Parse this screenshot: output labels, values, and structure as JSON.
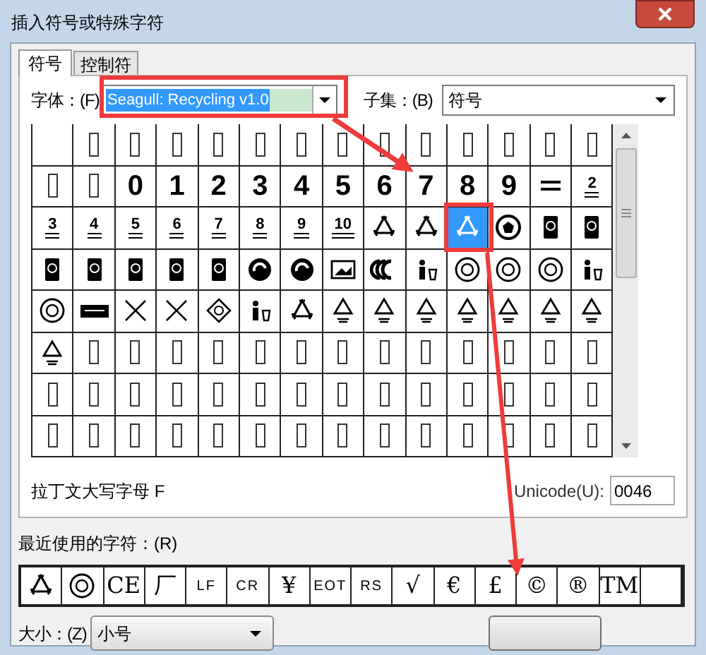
{
  "window": {
    "title": "插入符号或特殊字符"
  },
  "tabs": [
    {
      "label": "符号",
      "selected": true
    },
    {
      "label": "控制符",
      "selected": false
    }
  ],
  "font": {
    "label": "字体：",
    "mnemonic": "(F)",
    "value": "Seagull: Recycling v1.0",
    "highlighted": true
  },
  "subset": {
    "label": "子集：",
    "mnemonic": "(B)",
    "value": "符号"
  },
  "grid": {
    "rows": [
      {
        "cells": [
          {
            "kind": "empty",
            "selected": false
          },
          {
            "kind": "missing",
            "selected": false
          },
          {
            "kind": "missing",
            "selected": false
          },
          {
            "kind": "missing",
            "selected": false
          },
          {
            "kind": "missing",
            "selected": false
          },
          {
            "kind": "missing",
            "selected": false
          },
          {
            "kind": "missing",
            "selected": false
          },
          {
            "kind": "missing",
            "selected": false
          },
          {
            "kind": "missing",
            "selected": false
          },
          {
            "kind": "missing",
            "selected": false
          },
          {
            "kind": "missing",
            "selected": false
          },
          {
            "kind": "missing",
            "selected": false
          },
          {
            "kind": "missing",
            "selected": false
          },
          {
            "kind": "missing",
            "selected": false
          }
        ]
      },
      {
        "cells": [
          {
            "kind": "missing",
            "selected": false
          },
          {
            "kind": "missing",
            "selected": false
          },
          {
            "kind": "digit",
            "text": "0",
            "selected": false
          },
          {
            "kind": "digit",
            "text": "1",
            "selected": false
          },
          {
            "kind": "digit",
            "text": "2",
            "selected": false
          },
          {
            "kind": "digit",
            "text": "3",
            "selected": false
          },
          {
            "kind": "digit",
            "text": "4",
            "selected": false
          },
          {
            "kind": "digit",
            "text": "5",
            "selected": false
          },
          {
            "kind": "digit",
            "text": "6",
            "selected": false
          },
          {
            "kind": "digit",
            "text": "7",
            "selected": false
          },
          {
            "kind": "digit",
            "text": "8",
            "selected": false
          },
          {
            "kind": "digit",
            "text": "9",
            "selected": false
          },
          {
            "kind": "bars",
            "selected": false
          },
          {
            "kind": "numbered",
            "text": "2",
            "selected": false
          }
        ]
      },
      {
        "cells": [
          {
            "kind": "numbered",
            "text": "3",
            "selected": false
          },
          {
            "kind": "numbered",
            "text": "4",
            "selected": false
          },
          {
            "kind": "numbered",
            "text": "5",
            "selected": false
          },
          {
            "kind": "numbered",
            "text": "6",
            "selected": false
          },
          {
            "kind": "numbered",
            "text": "7",
            "selected": false
          },
          {
            "kind": "numbered",
            "text": "8",
            "selected": false
          },
          {
            "kind": "numbered",
            "text": "9",
            "selected": false
          },
          {
            "kind": "numbered",
            "text": "10",
            "selected": false
          },
          {
            "kind": "recycle",
            "selected": false
          },
          {
            "kind": "recycle",
            "selected": false
          },
          {
            "kind": "recycle",
            "selected": true
          },
          {
            "kind": "disc",
            "selected": false
          },
          {
            "kind": "tag",
            "selected": false
          },
          {
            "kind": "tag",
            "selected": false
          }
        ]
      },
      {
        "cells": [
          {
            "kind": "tag",
            "selected": false
          },
          {
            "kind": "tag",
            "selected": false
          },
          {
            "kind": "tag",
            "selected": false
          },
          {
            "kind": "tag",
            "selected": false
          },
          {
            "kind": "tag",
            "selected": false
          },
          {
            "kind": "swirl",
            "selected": false
          },
          {
            "kind": "swirl",
            "selected": false
          },
          {
            "kind": "photo",
            "selected": false
          },
          {
            "kind": "arcs",
            "selected": false
          },
          {
            "kind": "figure",
            "selected": false
          },
          {
            "kind": "seal",
            "selected": false
          },
          {
            "kind": "seal",
            "selected": false
          },
          {
            "kind": "seal",
            "selected": false
          },
          {
            "kind": "figure",
            "selected": false
          }
        ]
      },
      {
        "cells": [
          {
            "kind": "seal",
            "selected": false
          },
          {
            "kind": "banner",
            "selected": false
          },
          {
            "kind": "cross",
            "selected": false
          },
          {
            "kind": "cross",
            "selected": false
          },
          {
            "kind": "diamond",
            "selected": false
          },
          {
            "kind": "figure",
            "selected": false
          },
          {
            "kind": "recycle",
            "selected": false
          },
          {
            "kind": "code",
            "selected": false
          },
          {
            "kind": "code",
            "selected": false
          },
          {
            "kind": "code",
            "selected": false
          },
          {
            "kind": "code",
            "selected": false
          },
          {
            "kind": "code",
            "selected": false
          },
          {
            "kind": "code",
            "selected": false
          },
          {
            "kind": "code",
            "selected": false
          }
        ]
      },
      {
        "cells": [
          {
            "kind": "code",
            "selected": false
          },
          {
            "kind": "missing",
            "selected": false
          },
          {
            "kind": "missing",
            "selected": false
          },
          {
            "kind": "missing",
            "selected": false
          },
          {
            "kind": "missing",
            "selected": false
          },
          {
            "kind": "missing",
            "selected": false
          },
          {
            "kind": "missing",
            "selected": false
          },
          {
            "kind": "missing",
            "selected": false
          },
          {
            "kind": "missing",
            "selected": false
          },
          {
            "kind": "missing",
            "selected": false
          },
          {
            "kind": "missing",
            "selected": false
          },
          {
            "kind": "missing",
            "selected": false
          },
          {
            "kind": "missing",
            "selected": false
          },
          {
            "kind": "missing",
            "selected": false
          }
        ]
      },
      {
        "cells": [
          {
            "kind": "missing",
            "selected": false
          },
          {
            "kind": "missing",
            "selected": false
          },
          {
            "kind": "missing",
            "selected": false
          },
          {
            "kind": "missing",
            "selected": false
          },
          {
            "kind": "missing",
            "selected": false
          },
          {
            "kind": "missing",
            "selected": false
          },
          {
            "kind": "missing",
            "selected": false
          },
          {
            "kind": "missing",
            "selected": false
          },
          {
            "kind": "missing",
            "selected": false
          },
          {
            "kind": "missing",
            "selected": false
          },
          {
            "kind": "missing",
            "selected": false
          },
          {
            "kind": "missing",
            "selected": false
          },
          {
            "kind": "missing",
            "selected": false
          },
          {
            "kind": "missing",
            "selected": false
          }
        ]
      },
      {
        "cells": [
          {
            "kind": "missing",
            "selected": false
          },
          {
            "kind": "missing",
            "selected": false
          },
          {
            "kind": "missing",
            "selected": false
          },
          {
            "kind": "missing",
            "selected": false
          },
          {
            "kind": "missing",
            "selected": false
          },
          {
            "kind": "missing",
            "selected": false
          },
          {
            "kind": "missing",
            "selected": false
          },
          {
            "kind": "missing",
            "selected": false
          },
          {
            "kind": "missing",
            "selected": false
          },
          {
            "kind": "missing",
            "selected": false
          },
          {
            "kind": "missing",
            "selected": false
          },
          {
            "kind": "missing",
            "selected": false
          },
          {
            "kind": "missing",
            "selected": false
          },
          {
            "kind": "missing",
            "selected": false
          }
        ]
      }
    ]
  },
  "character_name": "拉丁文大写字母 F",
  "unicode": {
    "label": "Unicode",
    "mnemonic": "(U):",
    "value": "0046"
  },
  "recent": {
    "label": "最近使用的字符：",
    "mnemonic": "(R)",
    "items": [
      {
        "kind": "recycle"
      },
      {
        "kind": "seal"
      },
      {
        "kind": "text",
        "text": "CE"
      },
      {
        "kind": "text",
        "text": "厂"
      },
      {
        "kind": "code",
        "text": "LF"
      },
      {
        "kind": "code",
        "text": "CR"
      },
      {
        "kind": "text",
        "text": "¥"
      },
      {
        "kind": "code",
        "text": "EOT"
      },
      {
        "kind": "code",
        "text": "RS"
      },
      {
        "kind": "text",
        "text": "√"
      },
      {
        "kind": "text",
        "text": "€"
      },
      {
        "kind": "text",
        "text": "£"
      },
      {
        "kind": "text",
        "text": "©"
      },
      {
        "kind": "text",
        "text": "®"
      },
      {
        "kind": "text",
        "text": "TM"
      },
      {
        "kind": "empty"
      }
    ]
  },
  "size": {
    "label": "大小：",
    "mnemonic": "(Z)",
    "value": "小号"
  }
}
